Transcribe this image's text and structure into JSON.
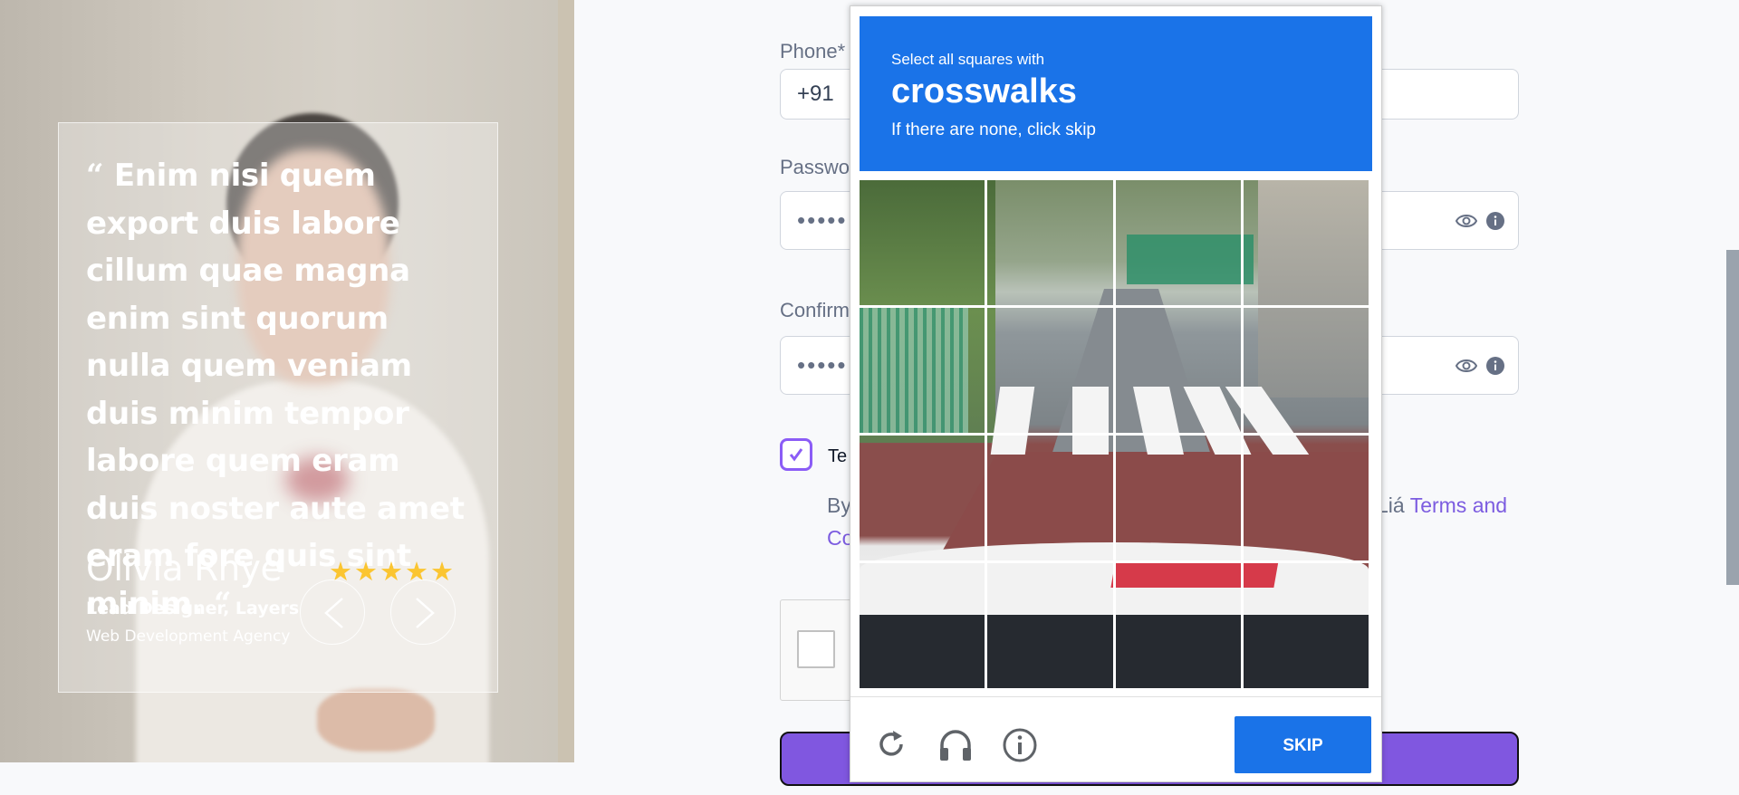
{
  "testimonial": {
    "quote_open": "“",
    "quote": "Enim nisi quem export duis labore cillum quae magna enim sint quorum nulla quem veniam duis minim tempor labore quem eram duis noster aute amet eram fore quis sint minim.",
    "quote_close": "“",
    "author_name": "Olivia Rhye",
    "author_role": "Lead Designer, Layers",
    "author_company": "Web Development Agency",
    "rating": 5,
    "stars": "★★★★★",
    "star_color": "#fbc531"
  },
  "form": {
    "phone_label": "Phone*",
    "phone_prefix": "+91",
    "password_label": "Password",
    "password_value": "•••••",
    "confirm_label": "Confirm",
    "confirm_value": "•••••",
    "terms_checked": true,
    "terms_label": "Te",
    "terms_prefix": "By",
    "terms_mid": "Liá",
    "terms_link_start": "Terms and",
    "terms_link_end": "Co",
    "accent_color": "#8057e0"
  },
  "captcha": {
    "instruction_small": "Select all squares with",
    "target": "crosswalks",
    "instruction_sub": "If there are none, click skip",
    "skip_label": "SKIP",
    "header_color": "#1a73e8",
    "icons": [
      "reload-icon",
      "audio-icon",
      "info-icon"
    ]
  }
}
